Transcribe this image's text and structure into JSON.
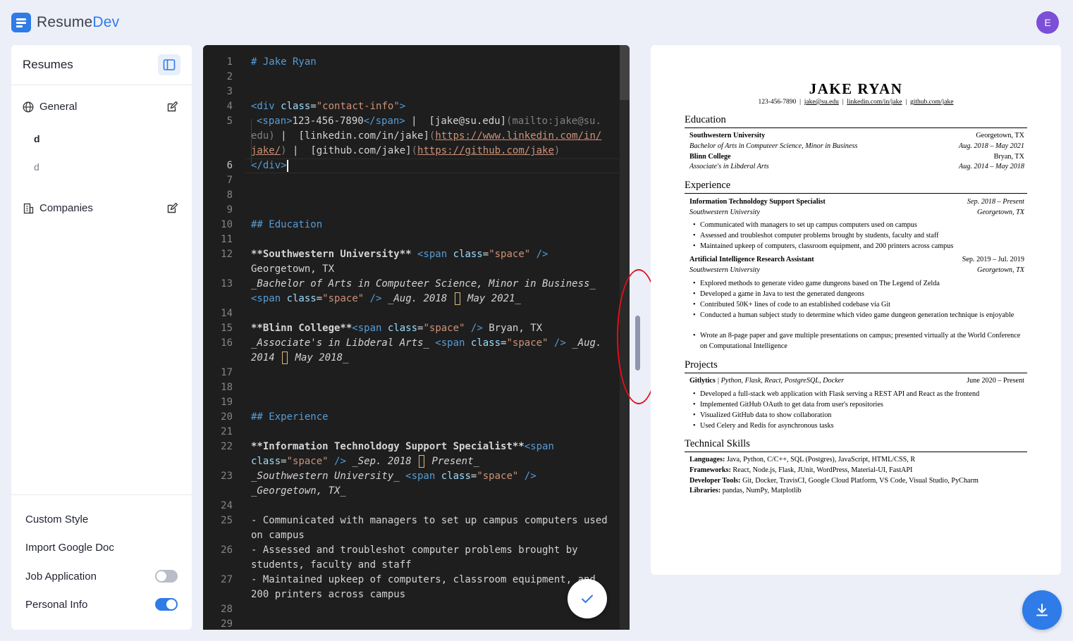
{
  "app": {
    "name_part1": "Resume",
    "name_part2": "Dev",
    "avatar_initial": "E"
  },
  "sidebar": {
    "title": "Resumes",
    "general_label": "General",
    "resume_items": [
      "d",
      "d"
    ],
    "companies_label": "Companies",
    "footer": {
      "custom_style": "Custom Style",
      "import_google_doc": "Import Google Doc",
      "job_application": "Job Application",
      "job_application_on": false,
      "personal_info": "Personal Info",
      "personal_info_on": true
    }
  },
  "editor": {
    "line_numbers": [
      "1",
      "2",
      "3",
      "4",
      "5",
      "6",
      "7",
      "8",
      "9",
      "10",
      "11",
      "12",
      "13",
      "14",
      "15",
      "16",
      "17",
      "18",
      "19",
      "20",
      "21",
      "22",
      "23",
      "24",
      "25",
      "26",
      "27",
      "28",
      "29"
    ],
    "lines": {
      "l1": "# Jake Ryan",
      "l4": [
        "<div ",
        "class",
        "=",
        "\"contact-info\"",
        ">"
      ],
      "l5a": [
        "<span>",
        "123-456-7890",
        "</span>",
        " |  ",
        "[jake@su.edu]",
        "(mailto:jake@su."
      ],
      "l5b": [
        "edu)",
        " |  ",
        "[linkedin.com/in/jake]",
        "(",
        "https://www.linkedin.com/in/"
      ],
      "l5c": [
        "jake/",
        ")",
        " |  ",
        "[github.com/jake]",
        "(",
        "https://github.com/jake",
        ")"
      ],
      "l6": "</div>",
      "l10": "## Education",
      "l12a": [
        "**Southwestern University**",
        " <span ",
        "class",
        "=",
        "\"space\"",
        " />"
      ],
      "l12b": "Georgetown, TX",
      "l13a": "_Bachelor of Arts in Computeer Science, Minor in Business_",
      "l13b": [
        "<span ",
        "class",
        "=",
        "\"space\"",
        " />",
        " _Aug. 2018 ",
        " May 2021_"
      ],
      "l15": [
        "**Blinn College**",
        "<span ",
        "class",
        "=",
        "\"space\"",
        " />",
        " Bryan, TX"
      ],
      "l16a": [
        "_Associate's in Libderal Arts_",
        " <span ",
        "class",
        "=",
        "\"space\"",
        " />",
        " _Aug."
      ],
      "l16b": [
        "2014 ",
        " May 2018_"
      ],
      "l20": "## Experience",
      "l22a": [
        "**Information Technoldogy Support Specialist**",
        "<span"
      ],
      "l22b": [
        "class",
        "=",
        "\"space\"",
        " />",
        " _Sep. 2018 ",
        " Present_"
      ],
      "l23a": [
        "_Southwestern University_",
        " <span ",
        "class",
        "=",
        "\"space\"",
        " />"
      ],
      "l23b": "_Georgetown, TX_",
      "l25a": "- Communicated with managers to set up campus computers used",
      "l25b": "on campus",
      "l26a": "- Assessed and troubleshot computer problems brought by",
      "l26b": "students, faculty and staff",
      "l27a": "- Maintained upkeep of computers, classroom equipment, and",
      "l27b": "200 printers across campus"
    }
  },
  "preview": {
    "name": "JAKE RYAN",
    "contact": {
      "phone": "123-456-7890",
      "email": "jake@su.edu",
      "linkedin": "linkedin.com/in/jake",
      "github": "github.com/jake",
      "sep": "|"
    },
    "education": {
      "title": "Education",
      "rows": [
        {
          "l": "Southwestern University",
          "r": "Georgetown, TX"
        },
        {
          "l": "Bachelor of Arts in Computeer Science, Minor in Business",
          "r": "Aug. 2018 – May 2021"
        },
        {
          "l": "Blinn College",
          "r": "Bryan, TX"
        },
        {
          "l": "Associate's in Libderal Arts",
          "r": "Aug. 2014 – May 2018"
        }
      ]
    },
    "experience": {
      "title": "Experience",
      "jobs": [
        {
          "title": "Information Technoldogy Support Specialist",
          "dates": "Sep. 2018 – Present",
          "org": "Southwestern University",
          "loc": "Georgetown, TX",
          "bullets": [
            "Communicated with managers to set up campus computers used on campus",
            "Assessed and troubleshot computer problems brought by students, faculty and staff",
            "Maintained upkeep of computers, classroom equipment, and 200 printers across campus"
          ]
        },
        {
          "title": "Artificial Intelligence Research Assistant",
          "dates": "Sep. 2019 – Jul. 2019",
          "org": "Southwestern University",
          "loc": "Georgetown, TX",
          "bullets": [
            "Explored methods to generate video game dungeons based on The Legend of Zelda",
            "Developed a game in Java to test the generated dungeons",
            "Contributed 50K+ lines of code to an established codebase via Git",
            "Conducted a human subject study to determine which video game dungeon generation technique is enjoyable",
            "Wrote an 8-page paper and gave multiple presentations on campus; presented virtually at the World Conference on Computational Intelligence"
          ]
        }
      ]
    },
    "projects": {
      "title": "Projects",
      "name": "Gitlytics",
      "tech": " | Python, Flask, React, PostgreSQL, Docker",
      "dates": "June 2020 – Present",
      "bullets": [
        "Developed a full-stack web application with Flask serving a REST API and React as the frontend",
        "Implemented GitHub OAuth to get data from user's repositories",
        "Visualized GitHub data to show collaboration",
        "Used Celery and Redis for asynchronous tasks"
      ]
    },
    "skills": {
      "title": "Technical Skills",
      "items": [
        {
          "k": "Languages:",
          "v": " Java, Python, C/C++, SQL (Postgres), JavaScript, HTML/CSS, R"
        },
        {
          "k": "Frameworks:",
          "v": " React, Node.js, Flask, JUnit, WordPress, Material-UI, FastAPI"
        },
        {
          "k": "Developer Tools:",
          "v": " Git, Docker, TravisCI, Google Cloud Platform, VS Code, Visual Studio, PyCharm"
        },
        {
          "k": "Libraries:",
          "v": " pandas, NumPy, Matplotlib"
        }
      ]
    }
  },
  "colors": {
    "accent": "#2f7be8",
    "avatar": "#7b4fd6",
    "annotation": "#e0101a"
  },
  "icons": {
    "logo": "document-icon",
    "panel": "sidebar-panel-icon",
    "general": "globe-icon",
    "edit": "edit-icon",
    "companies": "building-icon",
    "check": "check-icon",
    "download": "download-icon"
  }
}
